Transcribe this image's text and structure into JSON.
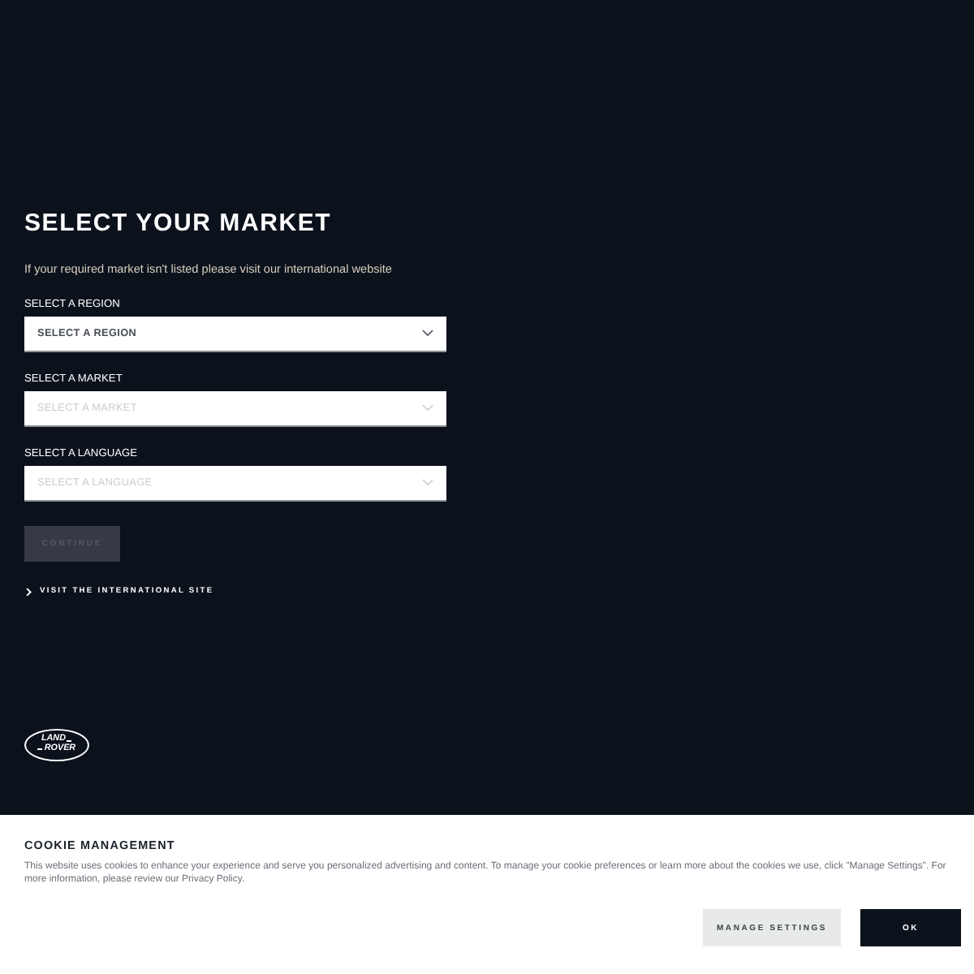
{
  "header": {
    "title": "SELECT YOUR MARKET",
    "subtitle": "If your required market isn't listed please visit our international website"
  },
  "selects": [
    {
      "label": "SELECT A REGION",
      "placeholder": "SELECT A REGION",
      "disabled": false
    },
    {
      "label": "SELECT A MARKET",
      "placeholder": "SELECT A MARKET",
      "disabled": true
    },
    {
      "label": "SELECT A LANGUAGE",
      "placeholder": "SELECT A LANGUAGE",
      "disabled": true
    }
  ],
  "continue_button": {
    "label": "CONTINUE",
    "disabled": true
  },
  "international_link": {
    "label": "VISIT THE INTERNATIONAL SITE"
  },
  "logo": {
    "lines": [
      "LAND",
      "ROVER"
    ]
  },
  "cookie_banner": {
    "title": "COOKIE MANAGEMENT",
    "text": "This website uses cookies to enhance your experience and serve you personalized advertising and content. To manage your cookie preferences or learn more about the cookies we use, click \"Manage Settings\". For more information, please review our Privacy Policy.",
    "buttons": [
      {
        "label": "MANAGE SETTINGS",
        "kind": "secondary"
      },
      {
        "label": "OK",
        "kind": "primary"
      }
    ]
  }
}
